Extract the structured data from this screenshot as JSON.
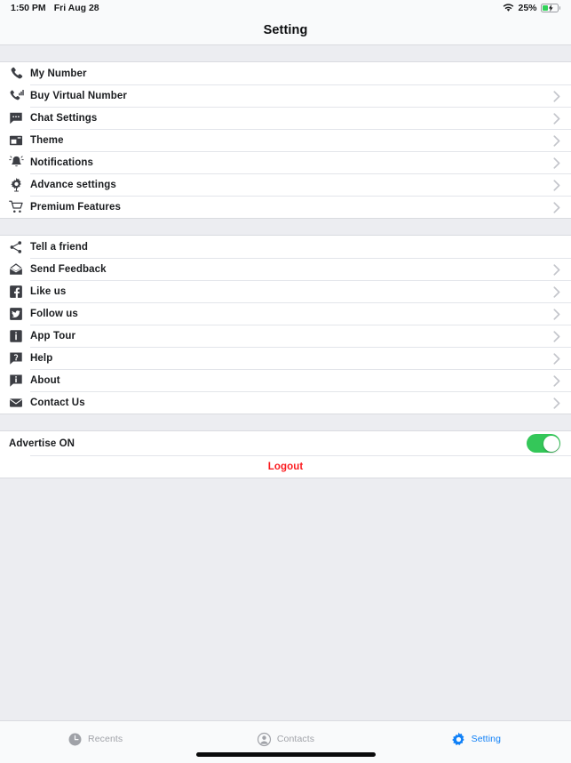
{
  "status_bar": {
    "time": "1:50 PM",
    "date": "Fri Aug 28",
    "battery_percent": "25%",
    "wifi_icon": "wifi-icon",
    "battery_icon": "battery-charging-icon"
  },
  "nav": {
    "title": "Setting"
  },
  "sections": [
    {
      "name": "account-section",
      "rows": [
        {
          "label": "My Number",
          "icon": "phone-icon",
          "chevron": false
        },
        {
          "label": "Buy Virtual Number",
          "icon": "phone-signal-icon",
          "chevron": true
        },
        {
          "label": "Chat Settings",
          "icon": "chat-bubble-icon",
          "chevron": true
        },
        {
          "label": "Theme",
          "icon": "theme-image-icon",
          "chevron": true
        },
        {
          "label": "Notifications",
          "icon": "bell-icon",
          "chevron": true
        },
        {
          "label": "Advance settings",
          "icon": "gear-icon",
          "chevron": true
        },
        {
          "label": "Premium Features",
          "icon": "cart-icon",
          "chevron": true
        }
      ]
    },
    {
      "name": "social-section",
      "rows": [
        {
          "label": "Tell a friend",
          "icon": "share-icon",
          "chevron": false
        },
        {
          "label": "Send Feedback",
          "icon": "open-envelope-icon",
          "chevron": true
        },
        {
          "label": "Like us",
          "icon": "facebook-icon",
          "chevron": true
        },
        {
          "label": "Follow us",
          "icon": "twitter-icon",
          "chevron": true
        },
        {
          "label": "App Tour",
          "icon": "info-square-icon",
          "chevron": true
        },
        {
          "label": "Help",
          "icon": "question-bubble-icon",
          "chevron": true
        },
        {
          "label": "About",
          "icon": "info-bubble-icon",
          "chevron": true
        },
        {
          "label": "Contact Us",
          "icon": "envelope-icon",
          "chevron": true
        }
      ]
    }
  ],
  "advertise": {
    "label": "Advertise ON",
    "toggle_state": "on",
    "toggle_color": "#34C759"
  },
  "logout": {
    "label": "Logout",
    "color": "#FB1C20"
  },
  "tabbar": {
    "tabs": [
      {
        "label": "Recents",
        "icon": "clock-icon",
        "active": false
      },
      {
        "label": "Contacts",
        "icon": "person-icon",
        "active": false
      },
      {
        "label": "Setting",
        "icon": "gear-icon",
        "active": true
      }
    ],
    "active_color": "#1080F7",
    "inactive_color": "#A0A2A8"
  }
}
